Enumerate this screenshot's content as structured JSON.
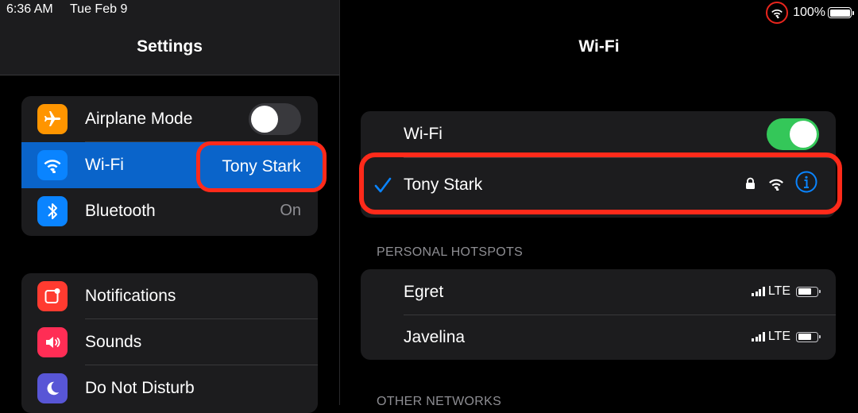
{
  "status_bar": {
    "time": "6:36 AM",
    "date": "Tue Feb 9",
    "battery": "100%",
    "battery_level": 1.0
  },
  "left": {
    "title": "Settings",
    "group1": [
      {
        "label": "Airplane Mode",
        "icon": "airplane-icon",
        "color": "#ff9500",
        "toggle": false
      },
      {
        "label": "Wi-Fi",
        "icon": "wifi-icon",
        "color": "#0a84ff",
        "value": "Tony Stark",
        "selected": true
      },
      {
        "label": "Bluetooth",
        "icon": "bluetooth-icon",
        "color": "#0a84ff",
        "value": "On"
      }
    ],
    "group2": [
      {
        "label": "Notifications",
        "icon": "notifications-icon",
        "color": "#ff3b30"
      },
      {
        "label": "Sounds",
        "icon": "speaker-icon",
        "color": "#ff2d55"
      },
      {
        "label": "Do Not Disturb",
        "icon": "moon-icon",
        "color": "#5856d6"
      }
    ]
  },
  "right": {
    "title": "Wi-Fi",
    "wifi_label": "Wi-Fi",
    "wifi_on": true,
    "connected_network": "Tony Stark",
    "personal_hotspots_header": "PERSONAL HOTSPOTS",
    "hotspots": [
      {
        "name": "Egret",
        "network": "LTE"
      },
      {
        "name": "Javelina",
        "network": "LTE"
      }
    ],
    "other_networks_header": "OTHER NETWORKS"
  },
  "colors": {
    "accent": "#0a84ff",
    "highlight": "#ff2a1a",
    "toggle_on": "#34c759"
  }
}
